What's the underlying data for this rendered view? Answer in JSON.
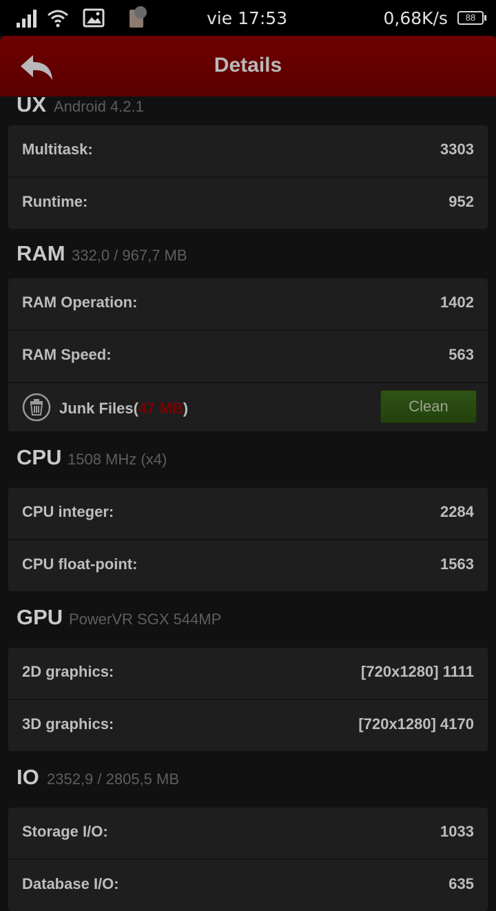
{
  "status_bar": {
    "time": "vie 17:53",
    "rate": "0,68K/s",
    "battery": "88"
  },
  "header": {
    "title": "Details"
  },
  "sections": {
    "ux": {
      "title": "UX",
      "subtitle": "Android 4.2.1",
      "rows": [
        {
          "label": "Multitask:",
          "value": "3303"
        },
        {
          "label": "Runtime:",
          "value": "952"
        }
      ]
    },
    "ram": {
      "title": "RAM",
      "subtitle": "332,0 / 967,7 MB",
      "rows": [
        {
          "label": "RAM Operation:",
          "value": "1402"
        },
        {
          "label": "RAM Speed:",
          "value": "563"
        }
      ],
      "junk": {
        "label": "Junk Files(",
        "size": "47 MB",
        "close": ")",
        "button": "Clean"
      }
    },
    "cpu": {
      "title": "CPU",
      "subtitle": "1508 MHz (x4)",
      "rows": [
        {
          "label": "CPU integer:",
          "value": "2284"
        },
        {
          "label": "CPU float-point:",
          "value": "1563"
        }
      ]
    },
    "gpu": {
      "title": "GPU",
      "subtitle": "PowerVR SGX 544MP",
      "rows": [
        {
          "label": "2D graphics:",
          "value": "[720x1280] 1111"
        },
        {
          "label": "3D graphics:",
          "value": "[720x1280] 4170"
        }
      ]
    },
    "io": {
      "title": "IO",
      "subtitle": "2352,9 / 2805,5 MB",
      "rows": [
        {
          "label": "Storage I/O:",
          "value": "1033"
        },
        {
          "label": "Database I/O:",
          "value": "635"
        }
      ]
    }
  },
  "colors": {
    "header": "#6e0000",
    "junk_size": "#7a0000",
    "clean_button": "#2f5316"
  }
}
